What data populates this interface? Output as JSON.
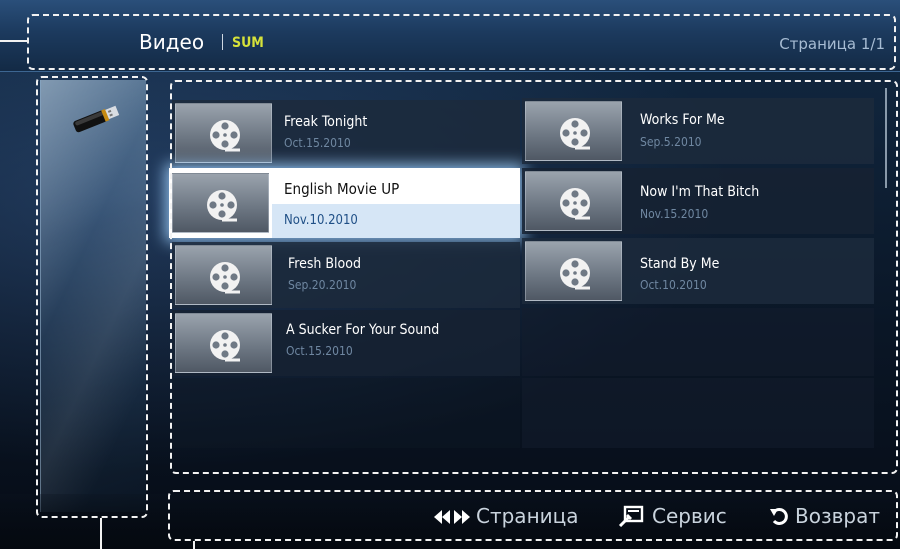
{
  "header": {
    "title": "Видео",
    "device": "SUM",
    "page": "Страница 1/1"
  },
  "files": {
    "left": [
      {
        "title": "Freak Tonight",
        "date": "Oct.15.2010",
        "selected": false
      },
      {
        "title": "English Movie UP",
        "date": "Nov.10.2010",
        "selected": true
      },
      {
        "title": "Fresh Blood",
        "date": "Sep.20.2010",
        "selected": false
      },
      {
        "title": "A Sucker For Your Sound",
        "date": "Oct.15.2010",
        "selected": false
      }
    ],
    "right": [
      {
        "title": "Works For Me",
        "date": "Sep.5.2010"
      },
      {
        "title": "Now I'm That Bitch",
        "date": "Nov.15.2010"
      },
      {
        "title": "Stand By Me",
        "date": "Oct.10.2010"
      }
    ]
  },
  "footer": {
    "page_label": "Страница",
    "tools_label": "Сервис",
    "return_label": "Возврат"
  },
  "icons": {
    "device": "usb-stick-icon",
    "file": "film-reel-icon",
    "page": "left-right-arrows-icon",
    "tools": "tools-icon",
    "return": "return-arrow-icon"
  },
  "colors": {
    "device_accent": "#d6e23a",
    "selection_glow": "#a0d2ff"
  }
}
